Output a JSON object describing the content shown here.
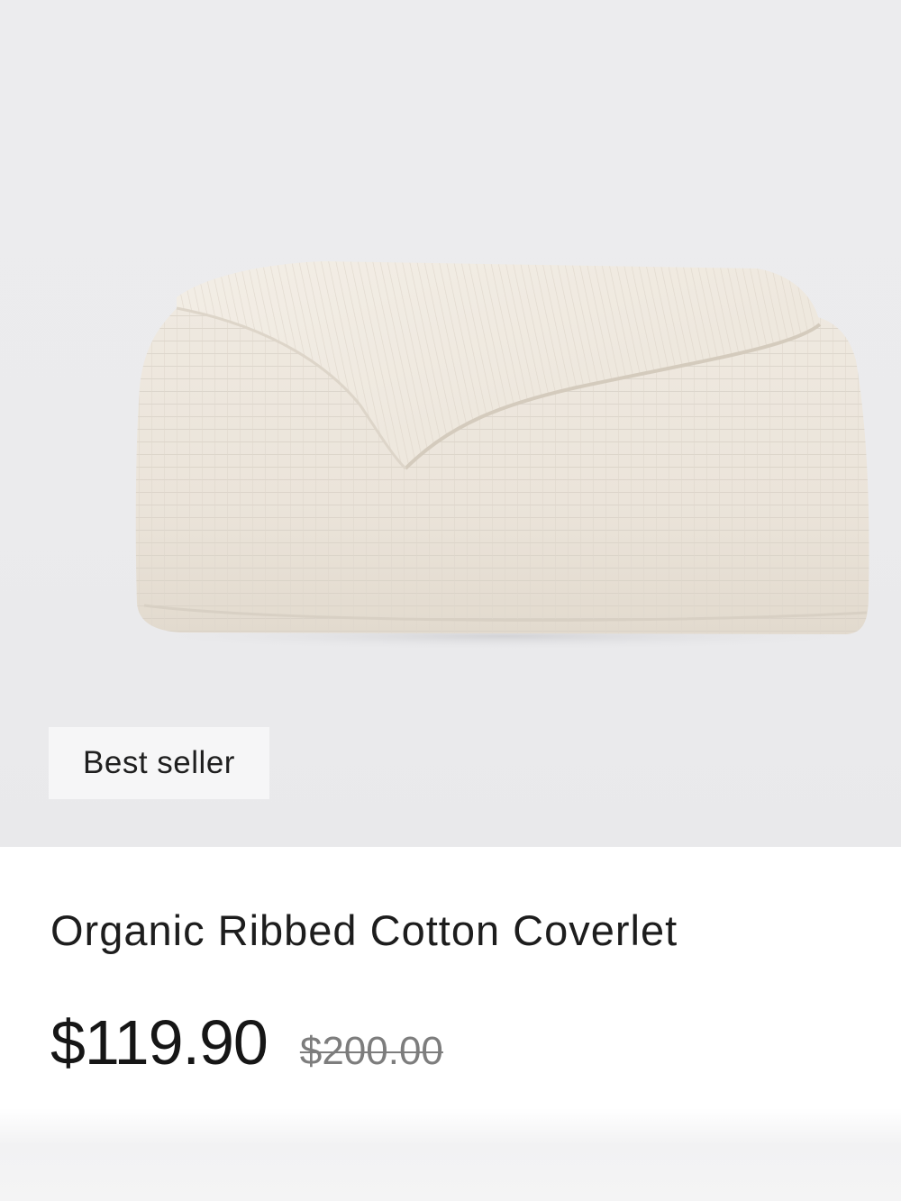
{
  "product": {
    "image_alt": "Folded ivory ribbed cotton coverlet",
    "badge": "Best seller",
    "title": "Organic Ribbed Cotton Coverlet",
    "price_current": "$119.90",
    "price_original": "$200.00"
  },
  "colors": {
    "image_background": "#ebebed",
    "fabric": "#e9e2d8",
    "badge_background": "#f6f6f7",
    "text": "#1c1c1c",
    "strikethrough_price": "#7d7d7d"
  }
}
